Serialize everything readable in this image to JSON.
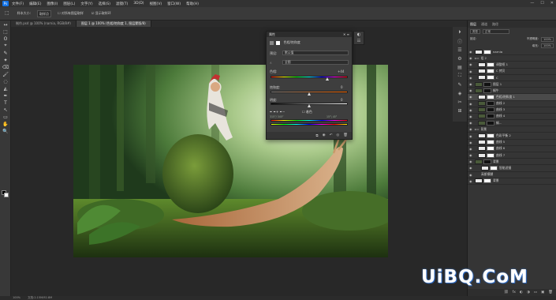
{
  "app": {
    "logo": "Ps"
  },
  "menubar": {
    "items": [
      "文件(F)",
      "编辑(E)",
      "图像(I)",
      "图层(L)",
      "文字(Y)",
      "选择(S)",
      "滤镜(T)",
      "3D(D)",
      "视图(V)",
      "窗口(W)",
      "帮助(H)"
    ],
    "minimize": "—",
    "maximize": "☐",
    "close": "✕"
  },
  "options": {
    "tool": "⬚",
    "sample_label": "样本大小:",
    "sample_value": "取样点",
    "all_layers": "对所有图层取样",
    "show_ring": "显示取样环"
  },
  "tabs": [
    {
      "label": "制作.psd @ 100% (narnia, RGB/8#)",
      "active": false
    },
    {
      "label": "图层 1 @ 100% (色相/饱和度 1, 图层蒙版/8)",
      "active": true
    }
  ],
  "status": {
    "zoom": "100%",
    "doc": "文档:2.15M/92.8M"
  },
  "properties": {
    "title": "属性",
    "close": "✕ ≡",
    "adjustment": "色相/饱和度",
    "preset_label": "预设:",
    "preset_value": "默认值",
    "channel": "全图",
    "hue_label": "色相:",
    "hue_value": "+44",
    "hue_pos": 0.73,
    "sat_label": "饱和度:",
    "sat_value": "0",
    "sat_pos": 0.5,
    "light_label": "明度:",
    "light_value": "0",
    "light_pos": 0.5,
    "colorize": "着色",
    "range_left": "315°/ 345°",
    "range_right": "15°\\ 45°",
    "footer_icons": [
      "⧉",
      "◉",
      "↶",
      "◎",
      "🗑"
    ]
  },
  "layers_panel": {
    "tabs": [
      {
        "label": "图层",
        "active": true
      },
      {
        "label": "通道",
        "active": false
      },
      {
        "label": "路径",
        "active": false
      }
    ],
    "filter": "类型",
    "blend": "正常",
    "opacity_label": "不透明度:",
    "opacity": "100%",
    "fill_label": "填充:",
    "fill": "100%",
    "lock_label": "锁定:",
    "layers": [
      {
        "name": "narnia",
        "thumb": "light",
        "sel": false,
        "indent": 0
      },
      {
        "name": "组 2",
        "thumb": "folder",
        "sel": false,
        "indent": 0
      },
      {
        "name": "调整框 1",
        "thumb": "light",
        "sel": false,
        "indent": 1
      },
      {
        "name": "C 拷贝",
        "thumb": "light",
        "sel": false,
        "indent": 1
      },
      {
        "name": "C",
        "thumb": "light",
        "sel": false,
        "indent": 1
      },
      {
        "name": "图层 1",
        "thumb": "dark",
        "sel": false,
        "indent": 0
      },
      {
        "name": "蜗牛",
        "thumb": "dark",
        "sel": false,
        "indent": 0
      },
      {
        "name": "色相/饱和度 1",
        "thumb": "light",
        "sel": true,
        "indent": 1
      },
      {
        "name": "曲线 2",
        "thumb": "dark",
        "sel": false,
        "indent": 1
      },
      {
        "name": "曲线 3",
        "thumb": "dark",
        "sel": false,
        "indent": 1
      },
      {
        "name": "曲线 4",
        "thumb": "dark",
        "sel": false,
        "indent": 1
      },
      {
        "name": "蜗...",
        "thumb": "dark",
        "sel": false,
        "indent": 1
      },
      {
        "name": "背景",
        "thumb": "folder",
        "sel": false,
        "indent": 0
      },
      {
        "name": "色彩平衡 2",
        "thumb": "light",
        "sel": false,
        "indent": 1
      },
      {
        "name": "曲线 5",
        "thumb": "light",
        "sel": false,
        "indent": 1
      },
      {
        "name": "曲线 6",
        "thumb": "light",
        "sel": false,
        "indent": 1
      },
      {
        "name": "曲线 7",
        "thumb": "light",
        "sel": false,
        "indent": 1
      },
      {
        "name": "背景",
        "thumb": "dark",
        "sel": false,
        "indent": 0
      },
      {
        "name": "智能滤镜",
        "thumb": "light",
        "sel": false,
        "indent": 2
      },
      {
        "name": "高斯模糊",
        "thumb": "none",
        "sel": false,
        "indent": 2
      },
      {
        "name": "背景",
        "thumb": "light",
        "sel": false,
        "indent": 0
      }
    ],
    "footer_icons": [
      "⛓",
      "fx",
      "◐",
      "◑",
      "▭",
      "▣",
      "🗑"
    ]
  },
  "tools": [
    "↔",
    "⬚",
    "ʘ",
    "⌖",
    "✎",
    "✦",
    "⌫",
    "🖌",
    "◌",
    "◭",
    "✒",
    "T",
    "↖",
    "▭",
    "✋",
    "🔍"
  ],
  "dock_icons": [
    "⏵",
    "ⓘ",
    "☰",
    "⚙",
    "▤",
    "⛶",
    "✎",
    "◈",
    "✂",
    "⊞"
  ],
  "watermark": "UiBQ.CoM"
}
